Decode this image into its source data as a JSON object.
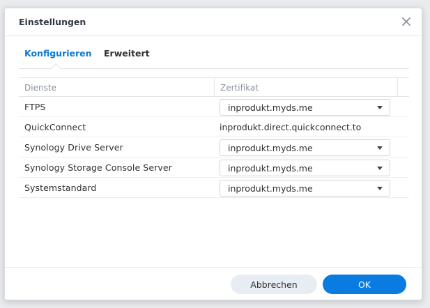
{
  "dialog": {
    "title": "Einstellungen",
    "close_icon": "close-icon"
  },
  "tabs": [
    {
      "label": "Konfigurieren",
      "active": true
    },
    {
      "label": "Erweitert",
      "active": false
    }
  ],
  "table": {
    "headers": [
      "Dienste",
      "Zertifikat"
    ],
    "rows": [
      {
        "service": "FTPS",
        "certificate": "inprodukt.myds.me",
        "type": "select"
      },
      {
        "service": "QuickConnect",
        "certificate": "inprodukt.direct.quickconnect.to",
        "type": "text"
      },
      {
        "service": "Synology Drive Server",
        "certificate": "inprodukt.myds.me",
        "type": "select"
      },
      {
        "service": "Synology Storage Console Server",
        "certificate": "inprodukt.myds.me",
        "type": "select"
      },
      {
        "service": "Systemstandard",
        "certificate": "inprodukt.myds.me",
        "type": "select"
      }
    ]
  },
  "footer": {
    "cancel_label": "Abbrechen",
    "ok_label": "OK"
  },
  "colors": {
    "accent": "#0a7be0",
    "active_tab": "#0a79d6"
  }
}
